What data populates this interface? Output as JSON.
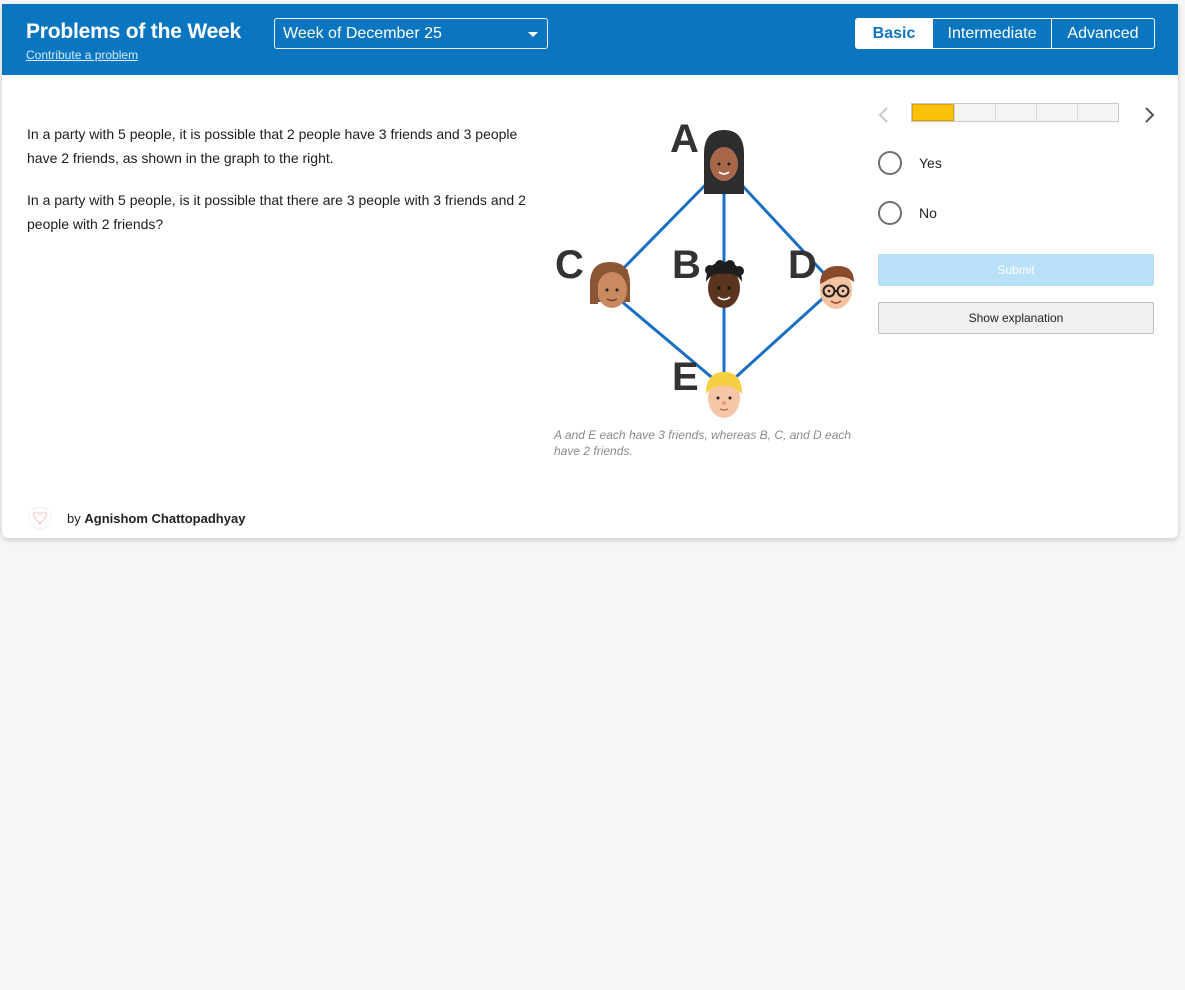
{
  "header": {
    "title": "Problems of the Week",
    "contribute_link": "Contribute a problem",
    "week_select": "Week of December 25",
    "levels": [
      "Basic",
      "Intermediate",
      "Advanced"
    ],
    "active_level": "Basic"
  },
  "problem": {
    "paragraph1": "In a party with 5 people, it is possible that 2 people have 3 friends and 3 people have 2 friends, as shown in the graph to the right.",
    "paragraph2": "In a party with 5 people, is it possible that there are 3 people with 3 friends and 2 people with 2 friends?"
  },
  "diagram": {
    "labels": {
      "a": "A",
      "b": "B",
      "c": "C",
      "d": "D",
      "e": "E"
    },
    "caption": "A and E each have 3 friends, whereas B, C, and D each have 2 friends.",
    "edge_color": "#1a6fc4"
  },
  "quiz": {
    "progress_current": 1,
    "progress_total": 5,
    "options": [
      "Yes",
      "No"
    ],
    "submit_label": "Submit",
    "explanation_label": "Show explanation"
  },
  "author": {
    "prefix": "by",
    "name": "Agnishom Chattopadhyay"
  },
  "colors": {
    "header_bg": "#0a76c0",
    "progress_fill": "#f9c10a",
    "submit_bg": "#b8e1f8"
  }
}
